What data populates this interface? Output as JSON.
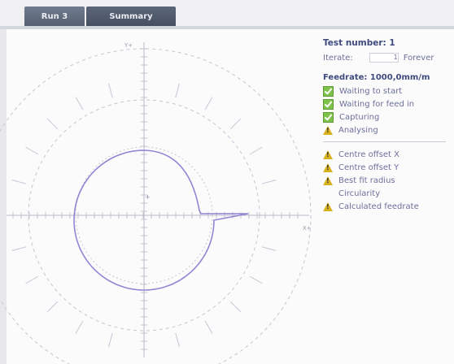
{
  "tabs": [
    {
      "label": "Run 3"
    },
    {
      "label": "Summary"
    }
  ],
  "info": {
    "test_number": "Test number: 1",
    "iterate_label": "Iterate:",
    "iterate_value": "1",
    "forever_label": "Forever",
    "feedrate": "Feedrate:  1000,0mm/m",
    "status": [
      {
        "label": "Waiting to start",
        "state": "ok"
      },
      {
        "label": "Waiting for feed in",
        "state": "ok"
      },
      {
        "label": "Capturing",
        "state": "ok"
      },
      {
        "label": "Analysing",
        "state": "warning"
      }
    ],
    "results": [
      {
        "label": "Centre offset X",
        "state": "warning"
      },
      {
        "label": "Centre offset Y",
        "state": "warning"
      },
      {
        "label": "Best fit radius",
        "state": "warning"
      },
      {
        "label": "Circularity",
        "state": "none"
      },
      {
        "label": "Calculated feedrate",
        "state": "warning"
      }
    ]
  },
  "plot": {
    "top_label": "Y+",
    "right_label": "X+",
    "center_marker": "+",
    "colors": {
      "trace": "#8f86d4",
      "axes": "#b8bac8",
      "rings": "#c4c6d2"
    }
  }
}
